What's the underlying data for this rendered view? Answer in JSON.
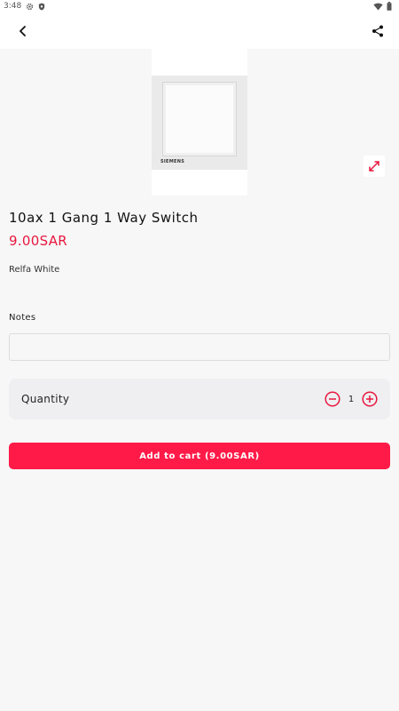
{
  "status_bar": {
    "time": "3:48",
    "left_icons": [
      "gear-icon",
      "shield-icon"
    ],
    "right_icons": [
      "wifi-icon",
      "battery-icon"
    ]
  },
  "app_bar": {
    "back_icon": "back-arrow-icon",
    "share_icon": "share-icon"
  },
  "product": {
    "image_brand": "SIEMENS",
    "title": "10ax 1 Gang 1 Way Switch",
    "price": "9.00SAR",
    "variant": "Relfa White"
  },
  "notes": {
    "label": "Notes",
    "value": "",
    "placeholder": ""
  },
  "quantity": {
    "label": "Quantity",
    "value": "1",
    "decrement_icon": "minus-circle-icon",
    "increment_icon": "plus-circle-icon"
  },
  "cart": {
    "button_label": "Add to cart (9.00SAR)"
  },
  "colors": {
    "accent": "#ff1a48",
    "price": "#e8173f",
    "background": "#f7f7f7"
  }
}
